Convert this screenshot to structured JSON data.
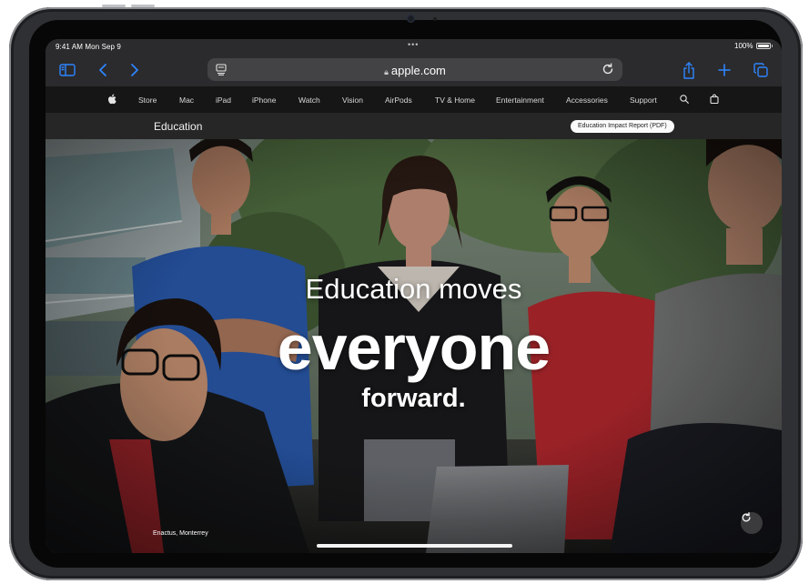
{
  "status": {
    "time": "9:41 AM",
    "date": "Mon Sep 9",
    "battery": "100%",
    "battery_level": 1.0
  },
  "toolbar": {
    "url": "apple.com",
    "icons": [
      "sidebar-icon",
      "back-icon",
      "forward-icon",
      "reader-icon",
      "reload-icon",
      "share-icon",
      "new-tab-icon",
      "tabs-icon"
    ],
    "accent": "#2e85ff"
  },
  "globalnav": {
    "items": [
      "Store",
      "Mac",
      "iPad",
      "iPhone",
      "Watch",
      "Vision",
      "AirPods",
      "TV & Home",
      "Entertainment",
      "Accessories",
      "Support"
    ]
  },
  "localnav": {
    "title": "Education",
    "button": "Education Impact Report (PDF)"
  },
  "hero": {
    "line1": "Education moves",
    "line2": "everyone",
    "line3": "forward.",
    "caption": "Enactus, Monterrey"
  },
  "colors": {
    "toolbar_bg": "#2b2b2d",
    "nav_bg": "#161617",
    "accent": "#2e85ff"
  }
}
